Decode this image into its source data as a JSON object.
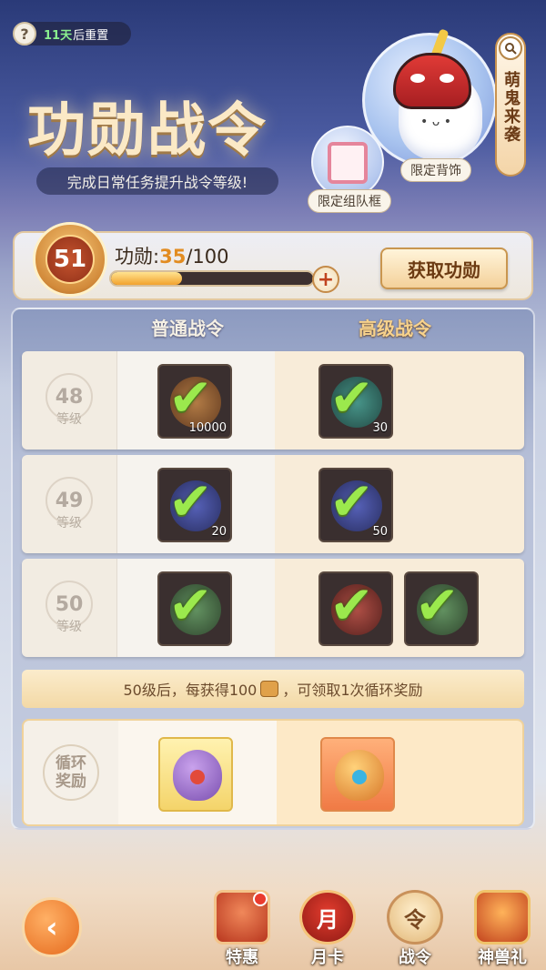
{
  "header": {
    "reset_days": "11天",
    "reset_suffix": "后重置",
    "help_glyph": "?",
    "title": "功勋战令",
    "subtitle": "完成日常任务提升战令等级!"
  },
  "promo": {
    "back_accessory_tag": "限定背饰",
    "team_frame_tag": "限定组队框",
    "side_tab": "萌鬼来袭",
    "search_icon": "search-icon"
  },
  "progress": {
    "level": "51",
    "label": "功勋:",
    "current": "35",
    "total": "/100",
    "fraction": 0.35,
    "get_button": "获取功勋",
    "plus": "+"
  },
  "columns": {
    "normal": "普通战令",
    "premium": "高级战令"
  },
  "rows": [
    {
      "level": "48",
      "unit": "等级",
      "normal": [
        {
          "icon": "bronze-coin-icon",
          "count": "10000",
          "claimed": true
        }
      ],
      "premium": [
        {
          "icon": "jade-shield-icon",
          "count": "30",
          "claimed": true
        }
      ]
    },
    {
      "level": "49",
      "unit": "等级",
      "normal": [
        {
          "icon": "purple-bag-icon",
          "count": "20",
          "claimed": true
        }
      ],
      "premium": [
        {
          "icon": "purple-bag-icon",
          "count": "50",
          "claimed": true
        }
      ]
    },
    {
      "level": "50",
      "unit": "等级",
      "normal": [
        {
          "icon": "green-ring-icon",
          "count": "",
          "claimed": true
        }
      ],
      "premium": [
        {
          "icon": "red-orb-icon",
          "count": "",
          "claimed": true
        },
        {
          "icon": "green-ring-icon",
          "count": "",
          "claimed": true
        }
      ]
    }
  ],
  "check_glyph": "✔",
  "loop": {
    "note_before": "50级后，每获得100",
    "note_after": "，可领取1次循环奖励",
    "label": "循环奖励"
  },
  "nav": {
    "back_glyph": "‹",
    "items": [
      {
        "label": "特惠",
        "icon": "chest-icon",
        "glyph": "",
        "badge": true
      },
      {
        "label": "月卡",
        "icon": "month-card-icon",
        "glyph": "月",
        "badge": false
      },
      {
        "label": "战令",
        "icon": "battle-pass-icon",
        "glyph": "令",
        "badge": false
      },
      {
        "label": "神兽礼",
        "icon": "beast-gift-icon",
        "glyph": "",
        "badge": false
      }
    ]
  },
  "colors": {
    "accent": "#e28c21",
    "check": "#9be94d",
    "premium_text": "#f7d28c"
  }
}
